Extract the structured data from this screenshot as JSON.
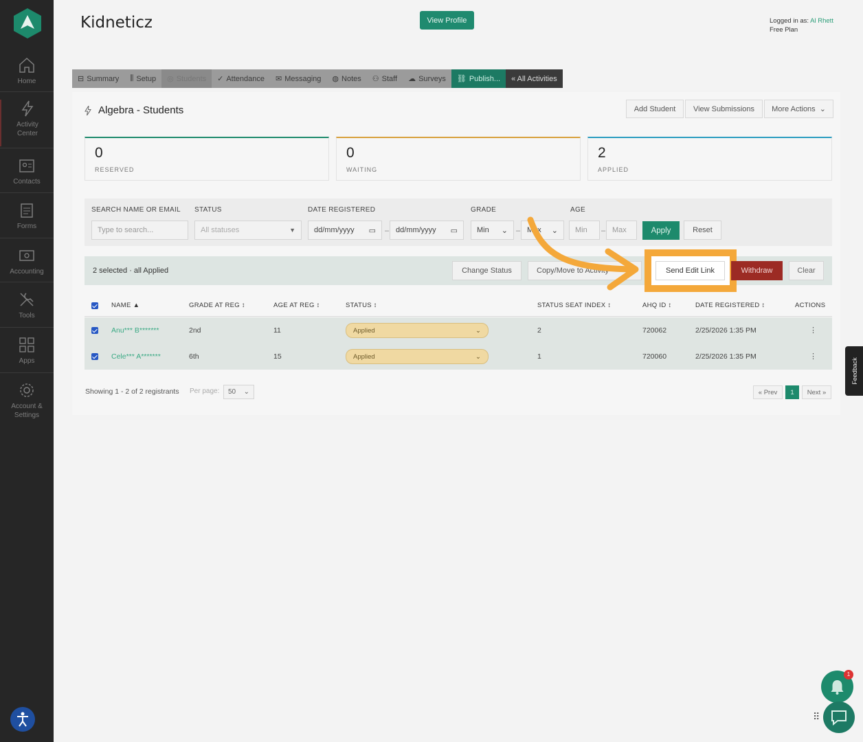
{
  "sidebar": {
    "items": [
      {
        "label": "Home",
        "icon": "home-icon"
      },
      {
        "label": "Activity Center",
        "icon": "lightning-icon"
      },
      {
        "label": "Contacts",
        "icon": "contacts-icon"
      },
      {
        "label": "Forms",
        "icon": "forms-icon"
      },
      {
        "label": "Accounting",
        "icon": "accounting-icon"
      },
      {
        "label": "Tools",
        "icon": "tools-icon"
      },
      {
        "label": "Apps",
        "icon": "apps-icon"
      },
      {
        "label": "Account & Settings",
        "icon": "gear-icon"
      }
    ]
  },
  "header": {
    "title": "Kidneticz",
    "view_profile": "View Profile",
    "logged_in_prefix": "Logged in as:",
    "user": "Al Rhett",
    "plan": "Free Plan"
  },
  "tabs": [
    {
      "label": "Summary",
      "icon": "summary-icon"
    },
    {
      "label": "Setup",
      "icon": "setup-icon"
    },
    {
      "label": "Students",
      "icon": "students-icon"
    },
    {
      "label": "Attendance",
      "icon": "check-icon"
    },
    {
      "label": "Messaging",
      "icon": "mail-icon"
    },
    {
      "label": "Notes",
      "icon": "notes-icon"
    },
    {
      "label": "Staff",
      "icon": "staff-icon"
    },
    {
      "label": "Surveys",
      "icon": "cloud-icon"
    },
    {
      "label": "Publish...",
      "icon": "link-icon"
    },
    {
      "label": "« All Activities",
      "icon": ""
    }
  ],
  "page": {
    "title": "Algebra - Students",
    "add_student": "Add Student",
    "view_submissions": "View Submissions",
    "more_actions": "More Actions"
  },
  "stats": [
    {
      "value": "0",
      "label": "RESERVED",
      "color": "#1d8a6c"
    },
    {
      "value": "0",
      "label": "WAITING",
      "color": "#d8a03c"
    },
    {
      "value": "2",
      "label": "APPLIED",
      "color": "#2a9cc0"
    }
  ],
  "filters": {
    "search_label": "SEARCH NAME OR EMAIL",
    "search_placeholder": "Type to search...",
    "status_label": "STATUS",
    "status_value": "All statuses",
    "date_label": "DATE REGISTERED",
    "date_from": "dd/mm/yyyy",
    "date_to": "dd/mm/yyyy",
    "grade_label": "GRADE",
    "grade_min": "Min",
    "grade_max": "Max",
    "age_label": "AGE",
    "age_min": "Min",
    "age_max": "Max",
    "apply": "Apply",
    "reset": "Reset"
  },
  "selection": {
    "text": "2 selected · all Applied",
    "change_status": "Change Status",
    "copy_move": "Copy/Move to Activity",
    "send_edit_link": "Send Edit Link",
    "withdraw": "Withdraw",
    "clear": "Clear"
  },
  "table": {
    "headers": [
      "NAME ▲",
      "GRADE AT REG ↕",
      "AGE AT REG ↕",
      "STATUS ↕",
      "STATUS SEAT INDEX ↕",
      "AHQ ID ↕",
      "DATE REGISTERED ↕",
      "ACTIONS"
    ],
    "rows": [
      {
        "name": "Anu*** B*******",
        "grade": "2nd",
        "age": "11",
        "status": "Applied",
        "seat": "2",
        "ahq": "720062",
        "date": "2/25/2026 1:35 PM"
      },
      {
        "name": "Cele*** A*******",
        "grade": "6th",
        "age": "15",
        "status": "Applied",
        "seat": "1",
        "ahq": "720060",
        "date": "2/25/2026 1:35 PM"
      }
    ]
  },
  "footer": {
    "showing": "Showing 1 - 2 of 2 registrants",
    "per_page_label": "Per page:",
    "per_page": "50",
    "prev": "« Prev",
    "page": "1",
    "next": "Next »"
  },
  "feedback": "Feedback",
  "notifications": {
    "badge": "1"
  },
  "colors": {
    "accent": "#1d8a6c",
    "highlight": "#f4a83a",
    "danger": "#9c2b24"
  }
}
